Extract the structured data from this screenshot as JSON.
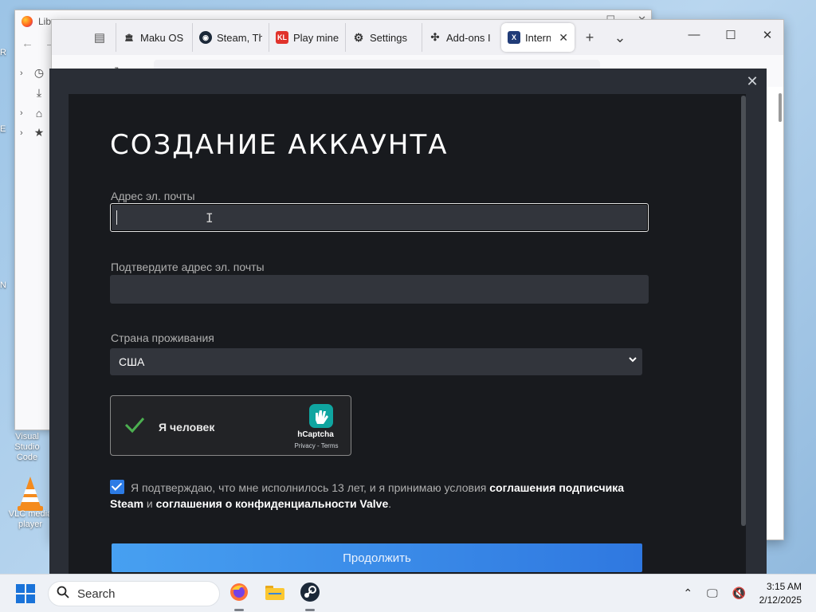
{
  "desktop": {
    "icons": [
      {
        "label": "Visual Studio Code"
      },
      {
        "label": "VLC media player"
      }
    ],
    "edge_labels": [
      "R",
      "E",
      "N"
    ]
  },
  "library_window": {
    "title": "Library",
    "tree": [
      "History",
      "Downloads",
      "Tags",
      "All Bookmarks"
    ]
  },
  "browser": {
    "tabs": [
      {
        "label": "Maku OS",
        "favicon": "bank-icon"
      },
      {
        "label": "Steam, Th",
        "favicon": "steam-icon"
      },
      {
        "label": "Play mine",
        "favicon": "kl-icon",
        "favicon_text": "KL"
      },
      {
        "label": "Settings",
        "favicon": "gear-icon"
      },
      {
        "label": "Add-ons I",
        "favicon": "puzzle-icon"
      },
      {
        "label": "Interne",
        "favicon": "x-icon",
        "favicon_text": "X",
        "active": true
      }
    ]
  },
  "form": {
    "title": "СОЗДАНИЕ АККАУНТА",
    "email_label": "Адрес эл. почты",
    "email_value": "",
    "confirm_label": "Подтвердите адрес эл. почты",
    "confirm_value": "",
    "country_label": "Страна проживания",
    "country_value": "США",
    "captcha": {
      "text": "Я человек",
      "brand": "hCaptcha",
      "links": "Privacy - Terms",
      "checked": true
    },
    "agree": {
      "checked": true,
      "text_1": "Я подтверждаю, что мне исполнилось 13 лет, и я принимаю условия ",
      "link_1": "соглашения подписчика Steam",
      "text_2": " и ",
      "link_2": "соглашения о конфиденциальности Valve",
      "text_3": "."
    },
    "continue_label": "Продолжить"
  },
  "taskbar": {
    "search_placeholder": "Search",
    "time": "3:15 AM",
    "date": "2/12/2025"
  },
  "colors": {
    "modal_bg": "#181a1e",
    "input_bg": "#32353c",
    "accent": "#2f78e0",
    "captcha_check": "#4caf50",
    "hcaptcha": "#0fa5a0"
  }
}
